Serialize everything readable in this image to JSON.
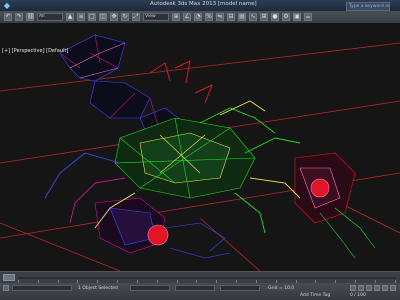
{
  "window": {
    "title": "Autodesk 3ds Max 2013    [model name]",
    "search_placeholder": "Type a keyword or phrase"
  },
  "toolbar": {
    "selection_filter": "All",
    "view_dropdown": "View"
  },
  "viewport": {
    "label": "[+] [Perspective] [Default]",
    "colors": {
      "background": "#151515",
      "grid_lines": "#b8242c",
      "wire_blue": "#3b46ff",
      "wire_magenta": "#d0108a",
      "wire_red": "#e01526",
      "wire_green": "#1de020",
      "wire_yellow": "#f0e64a",
      "wire_pink": "#ff70c8"
    }
  },
  "status": {
    "selection": "1 Object Selected",
    "add_time_tag": "Add Time Tag",
    "grid": "Grid = 10.0"
  },
  "timeline": {
    "position": "0 / 100"
  }
}
